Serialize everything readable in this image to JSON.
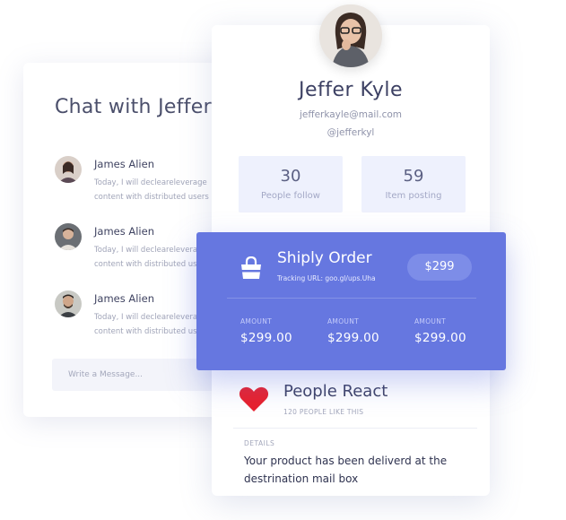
{
  "chat": {
    "title": "Chat with Jeffer",
    "messages": [
      {
        "name": "James Alien",
        "line1": "Today, I will decleareleverage",
        "line2": "content with distributed users"
      },
      {
        "name": "James Alien",
        "line1": "Today, I will decleareleverage",
        "line2": "content with distributed users"
      },
      {
        "name": "James Alien",
        "line1": "Today, I will decleareleverage",
        "line2": "content with distributed users"
      }
    ],
    "input_placeholder": "Write a Message..."
  },
  "profile": {
    "name": "Jeffer Kyle",
    "email": "jefferkayle@mail.com",
    "handle": "@jefferkyl",
    "stats": [
      {
        "value": "30",
        "label": "People follow"
      },
      {
        "value": "59",
        "label": "Item posting"
      }
    ]
  },
  "order": {
    "title": "Shiply Order",
    "tracking": "Tracking URL: goo.gl/ups.Uha",
    "price": "$299",
    "amounts": [
      {
        "label": "AMOUNT",
        "value": "$299.00"
      },
      {
        "label": "AMOUNT",
        "value": "$299.00"
      },
      {
        "label": "AMOUNT",
        "value": "$299.00"
      }
    ]
  },
  "react": {
    "title": "People React",
    "subtitle": "120 PEOPLE LIKE THIS",
    "details_label": "DETAILS",
    "details_text": "Your product has been deliverd at the destrination mail box"
  },
  "colors": {
    "accent": "#6677e0",
    "heart": "#e8202c",
    "stat_bg": "#eef1fd"
  },
  "icons": [
    "shopping-bag-icon",
    "heart-icon"
  ]
}
